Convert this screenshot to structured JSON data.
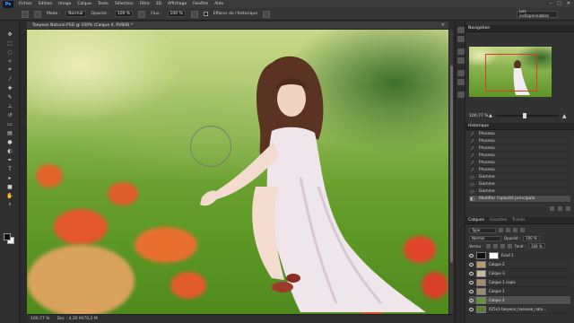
{
  "menubar": {
    "logo": "Ps",
    "items": [
      "Fichier",
      "Edition",
      "Image",
      "Calque",
      "Texte",
      "Sélection",
      "Filtre",
      "3D",
      "Affichage",
      "Fenêtre",
      "Aide"
    ],
    "controls": [
      "–",
      "□",
      "✕"
    ]
  },
  "options": {
    "mode_label": "Mode :",
    "mode_value": "Normal",
    "opacity_label": "Opacité :",
    "opacity_value": "100 %",
    "flow_label": "Flux :",
    "flow_value": "100 %",
    "history_label": "Effacer de l'historique",
    "workspace": "Les indispensables"
  },
  "document": {
    "tab_label": "Taeyeon Natural.PSD @ 100% (Calque 4, RVB/8) *",
    "close": "✕"
  },
  "status": {
    "zoom": "100,77 %",
    "doc": "Doc : 4,20 M/70,2 M"
  },
  "navigator": {
    "tabs": [
      "Navigation"
    ],
    "zoom_value": "100,77 %",
    "zoom_fraction": 0.46,
    "view_rect_color": "#e23a2a"
  },
  "history": {
    "tabs": [
      "Historique"
    ],
    "items": [
      {
        "label": "Pinceau",
        "icon": "brush-icon"
      },
      {
        "label": "Pinceau",
        "icon": "brush-icon"
      },
      {
        "label": "Pinceau",
        "icon": "brush-icon"
      },
      {
        "label": "Pinceau",
        "icon": "brush-icon"
      },
      {
        "label": "Pinceau",
        "icon": "brush-icon"
      },
      {
        "label": "Pinceau",
        "icon": "brush-icon"
      },
      {
        "label": "Gomme",
        "icon": "eraser-icon"
      },
      {
        "label": "Gomme",
        "icon": "eraser-icon"
      },
      {
        "label": "Gomme",
        "icon": "eraser-icon"
      },
      {
        "label": "Modifier l'opacité principale",
        "icon": "opacity-icon",
        "selected": true
      }
    ]
  },
  "layers": {
    "tabs": [
      "Calques",
      "Couches",
      "Tracés"
    ],
    "filter_value": "Type",
    "blend_value": "Normal",
    "opacity_label": "Opacité :",
    "opacity_value": "100 %",
    "lock_label": "Verrou :",
    "fill_label": "Fond :",
    "fill_value": "100 %",
    "items": [
      {
        "name": "Fond 1",
        "thumb": "#111111",
        "mask": true
      },
      {
        "name": "Calque 2",
        "thumb": "#b99a6a"
      },
      {
        "name": "Calque 3",
        "thumb": "#c8b8a0"
      },
      {
        "name": "Calque 1 copie",
        "thumb": "#a58c6e"
      },
      {
        "name": "Calque 1",
        "thumb": "#9a8a74"
      },
      {
        "name": "Calque 4",
        "thumb": "#6a8f3e",
        "selected": true
      },
      {
        "name": "425x1-taeyeon_haesuee_natu...",
        "thumb": "#5b7d35"
      }
    ]
  },
  "colors": {
    "accent": "#e23a2a",
    "foreground_swatch": "#101010",
    "background_swatch": "#f2f2f2"
  }
}
